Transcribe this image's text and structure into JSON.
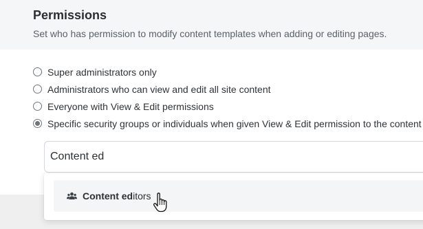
{
  "permissions": {
    "title": "Permissions",
    "description": "Set who has permission to modify content templates when adding or editing pages.",
    "options": [
      {
        "label": "Super administrators only",
        "checked": false
      },
      {
        "label": "Administrators who can view and edit all site content",
        "checked": false
      },
      {
        "label": "Everyone with View & Edit permissions",
        "checked": false
      },
      {
        "label": "Specific security groups or individuals when given View & Edit permission to the content",
        "checked": true
      }
    ]
  },
  "search": {
    "value": "Content ed"
  },
  "dropdown": {
    "option_label_bold": "Content ed",
    "option_label_rest": "itors",
    "option_icon": "group-icon"
  },
  "cursor": {
    "icon": "hand-pointer-icon"
  }
}
